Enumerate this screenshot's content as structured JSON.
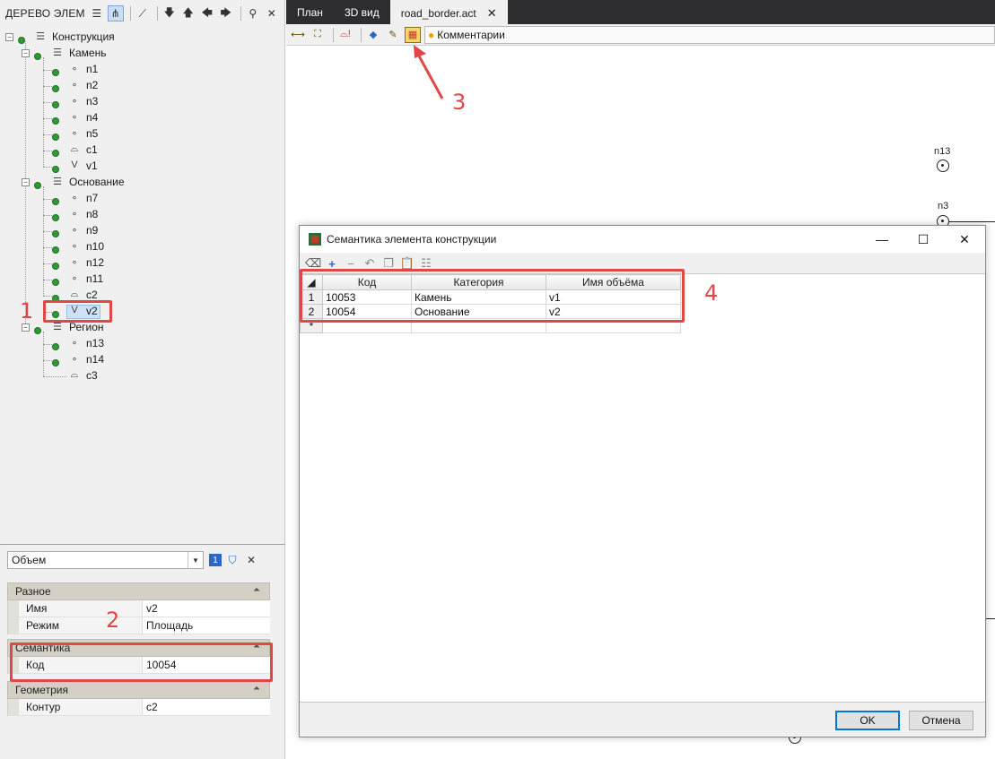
{
  "tree_panel": {
    "title": "ДЕРЕВО ЭЛЕМ",
    "nodes": [
      {
        "label": "Конструкция"
      },
      {
        "label": "Камень"
      },
      {
        "label": "n1"
      },
      {
        "label": "n2"
      },
      {
        "label": "n3"
      },
      {
        "label": "n4"
      },
      {
        "label": "n5"
      },
      {
        "label": "c1"
      },
      {
        "label": "v1"
      },
      {
        "label": "Основание"
      },
      {
        "label": "n7"
      },
      {
        "label": "n8"
      },
      {
        "label": "n9"
      },
      {
        "label": "n10"
      },
      {
        "label": "n12"
      },
      {
        "label": "n11"
      },
      {
        "label": "c2"
      },
      {
        "label": "v2"
      },
      {
        "label": "Регион"
      },
      {
        "label": "n13"
      },
      {
        "label": "n14"
      },
      {
        "label": "c3"
      }
    ]
  },
  "properties": {
    "combo_value": "Объем",
    "groups": [
      {
        "title": "Разное",
        "rows": [
          {
            "key": "Имя",
            "value": "v2"
          },
          {
            "key": "Режим",
            "value": "Площадь"
          }
        ]
      },
      {
        "title": "Семантика",
        "rows": [
          {
            "key": "Код",
            "value": "10054"
          }
        ]
      },
      {
        "title": "Геометрия",
        "rows": [
          {
            "key": "Контур",
            "value": "c2"
          }
        ]
      }
    ]
  },
  "tabs": [
    {
      "label": "План"
    },
    {
      "label": "3D вид"
    },
    {
      "label": "road_border.act",
      "active": true
    }
  ],
  "toolbar": {
    "comments_label": "Комментарии"
  },
  "canvas": {
    "points": [
      {
        "label": "n13"
      },
      {
        "label": "n3"
      }
    ]
  },
  "dialog": {
    "title": "Семантика элемента конструкции",
    "columns": [
      "Код",
      "Категория",
      "Имя объёма"
    ],
    "rows": [
      {
        "num": "1",
        "code": "10053",
        "category": "Камень",
        "volume": "v1"
      },
      {
        "num": "2",
        "code": "10054",
        "category": "Основание",
        "volume": "v2"
      }
    ],
    "new_row_marker": "*",
    "ok_label": "OK",
    "cancel_label": "Отмена"
  },
  "annotations": [
    "1",
    "2",
    "3",
    "4"
  ],
  "colors": {
    "annotation": "#e04848",
    "tab_bar": "#2d2d30",
    "check": "#2f9a33",
    "selection": "#cde2f7"
  }
}
